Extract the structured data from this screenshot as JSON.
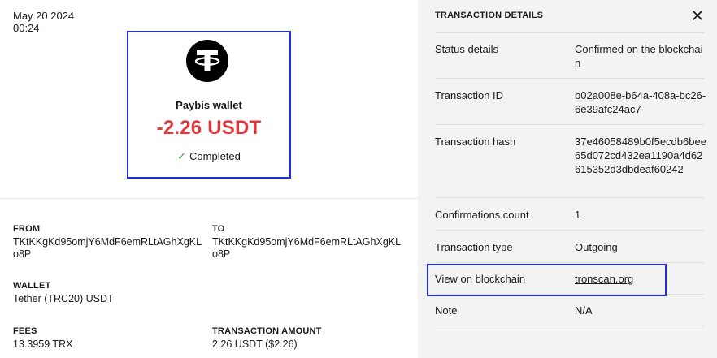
{
  "summary": {
    "date": "May 20 2024",
    "time": "00:24",
    "wallet_name": "Paybis wallet",
    "amount": "-2.26 USDT",
    "status": "Completed",
    "colors": {
      "amount": "#e0373f",
      "status_check": "#2e9a3a",
      "highlight": "#2230d6"
    },
    "coin_icon": "tether-icon"
  },
  "fields": {
    "from_label": "FROM",
    "from_value": "TKtKKgKd95omjY6MdF6emRLtAGhXgKLo8P",
    "to_label": "TO",
    "to_value": "TKtKKgKd95omjY6MdF6emRLtAGhXgKLo8P",
    "wallet_label": "WALLET",
    "wallet_value": "Tether (TRC20) USDT",
    "fees_label": "FEES",
    "fees_value": "13.3959 TRX",
    "amount_label": "TRANSACTION AMOUNT",
    "amount_value": "2.26 USDT ($2.26)"
  },
  "details": {
    "title": "TRANSACTION DETAILS",
    "rows": [
      {
        "key": "Status details",
        "value": "Confirmed on the blockchain"
      },
      {
        "key": "Transaction ID",
        "value": "b02a008e-b64a-408a-bc26-6e39afc24ac7"
      },
      {
        "key": "Transaction hash",
        "value": "37e46058489b0f5ecdb6bee65d072cd432ea1190a4d62615352d3dbdeaf60242"
      },
      {
        "key": "Confirmations count",
        "value": "1"
      },
      {
        "key": "Transaction type",
        "value": "Outgoing"
      },
      {
        "key": "View on blockchain",
        "value": "tronscan.org"
      },
      {
        "key": "Note",
        "value": "N/A"
      }
    ]
  }
}
